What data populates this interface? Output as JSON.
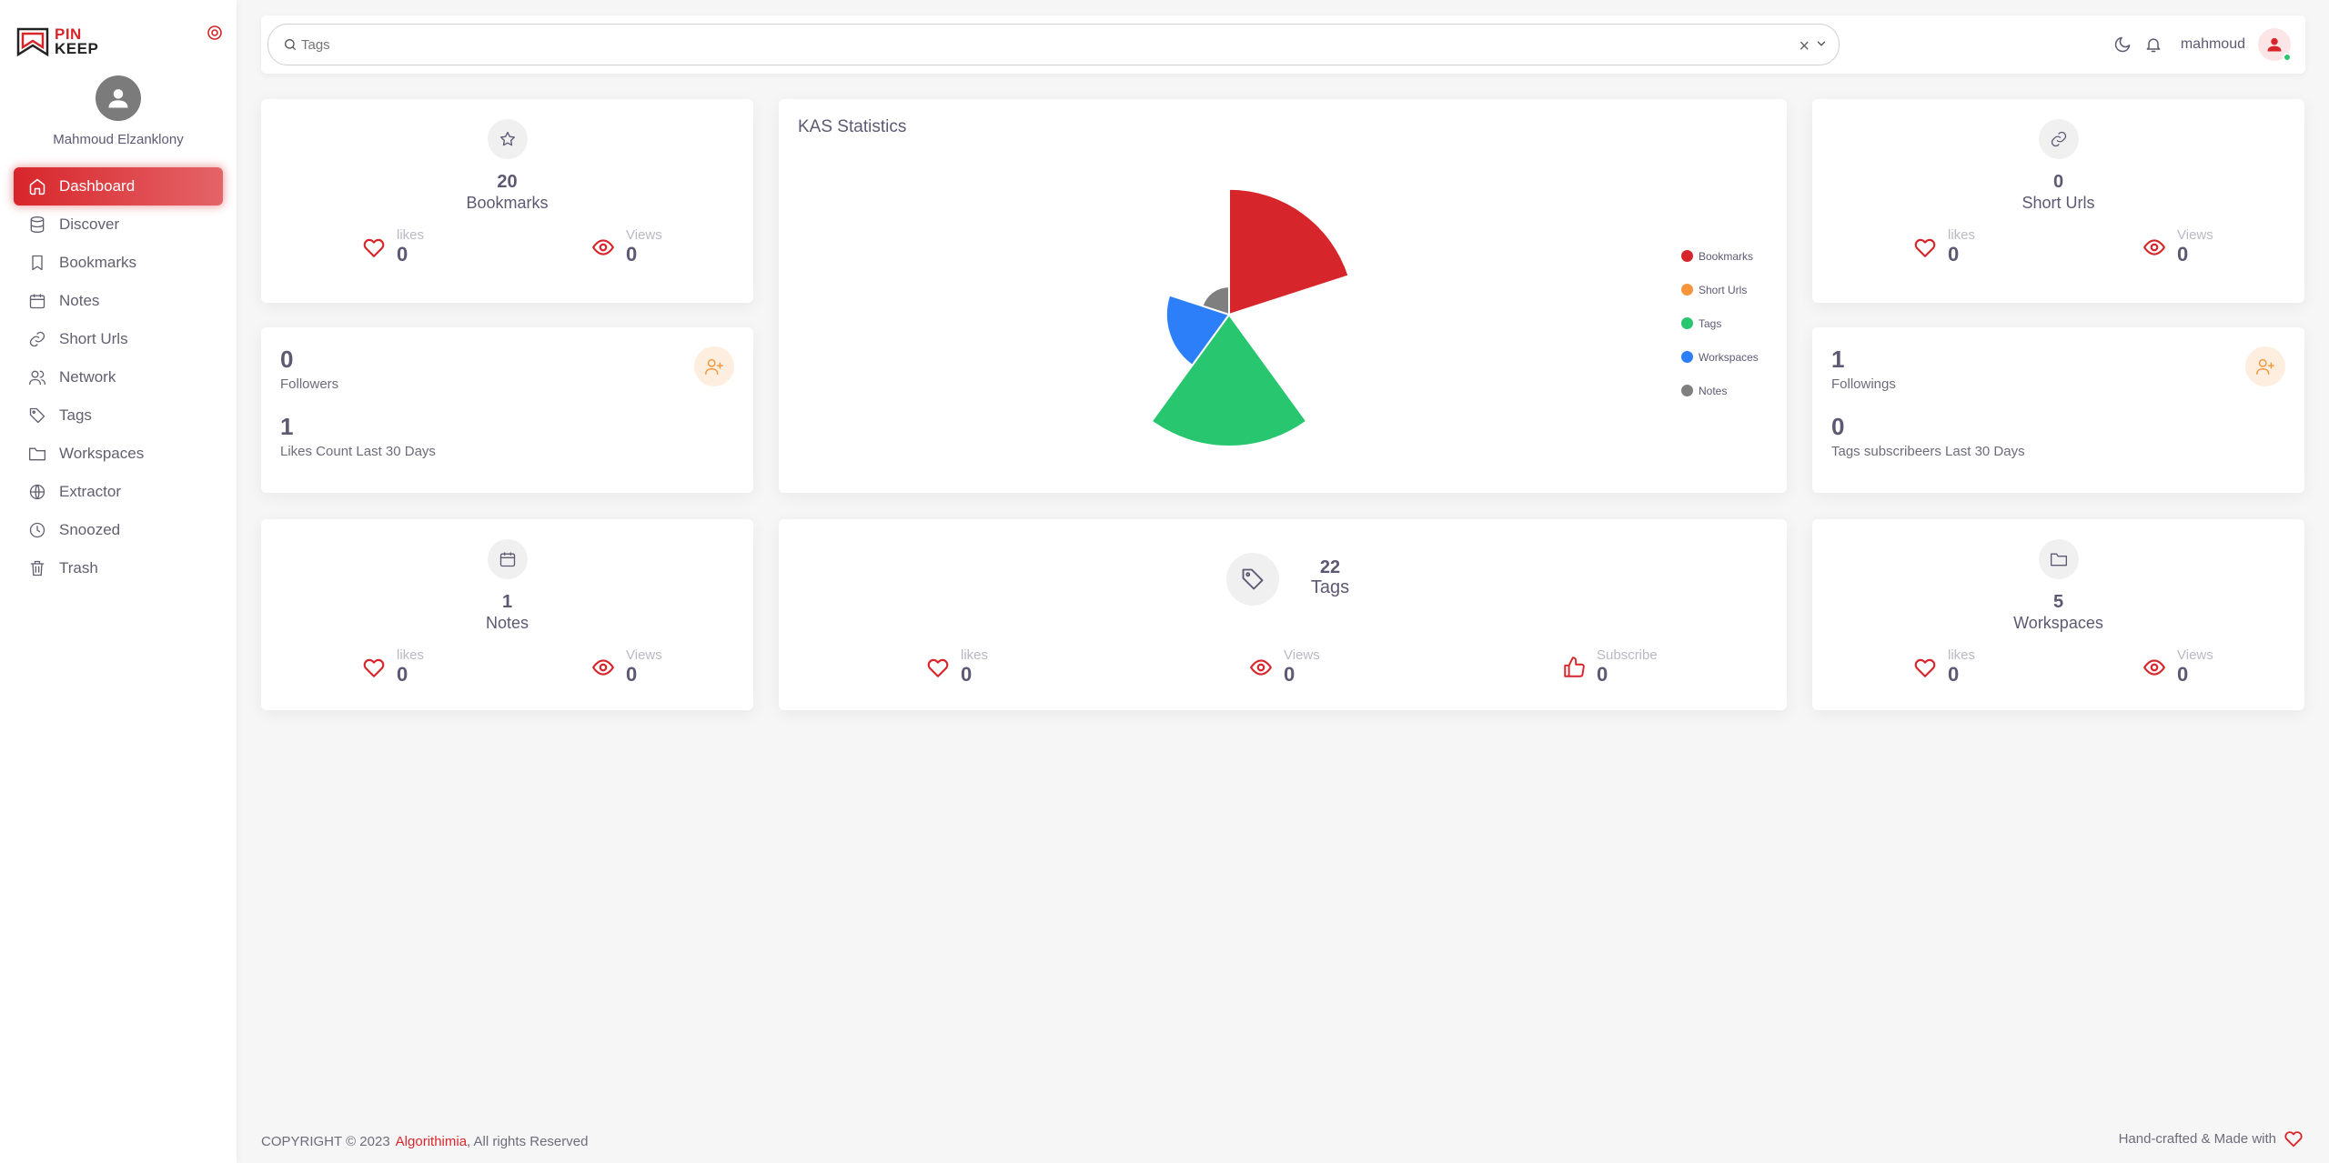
{
  "sidebar": {
    "logo": {
      "line1": "PIN",
      "line2": "KEEP"
    },
    "user_name": "Mahmoud Elzanklony",
    "items": [
      {
        "label": "Dashboard",
        "icon": "home-icon",
        "active": true
      },
      {
        "label": "Discover",
        "icon": "database-icon"
      },
      {
        "label": "Bookmarks",
        "icon": "bookmark-icon"
      },
      {
        "label": "Notes",
        "icon": "calendar-icon"
      },
      {
        "label": "Short Urls",
        "icon": "link-icon"
      },
      {
        "label": "Network",
        "icon": "users-icon"
      },
      {
        "label": "Tags",
        "icon": "tag-icon"
      },
      {
        "label": "Workspaces",
        "icon": "folder-icon"
      },
      {
        "label": "Extractor",
        "icon": "globe-icon"
      },
      {
        "label": "Snoozed",
        "icon": "clock-icon"
      },
      {
        "label": "Trash",
        "icon": "trash-icon"
      }
    ]
  },
  "header": {
    "search_placeholder": "Tags",
    "username": "mahmoud"
  },
  "cards": {
    "bookmarks": {
      "count": "20",
      "label": "Bookmarks",
      "likes_label": "likes",
      "likes": "0",
      "views_label": "Views",
      "views": "0"
    },
    "short_urls": {
      "count": "0",
      "label": "Short Urls",
      "likes_label": "likes",
      "likes": "0",
      "views_label": "Views",
      "views": "0"
    },
    "followers": {
      "count": "0",
      "label": "Followers",
      "sub_count": "1",
      "sub_label": "Likes Count Last 30 Days"
    },
    "followings": {
      "count": "1",
      "label": "Followings",
      "sub_count": "0",
      "sub_label": "Tags subscribeers Last 30 Days"
    },
    "notes": {
      "count": "1",
      "label": "Notes",
      "likes_label": "likes",
      "likes": "0",
      "views_label": "Views",
      "views": "0"
    },
    "tags": {
      "count": "22",
      "label": "Tags",
      "likes_label": "likes",
      "likes": "0",
      "views_label": "Views",
      "views": "0",
      "subscribe_label": "Subscribe",
      "subscribe": "0"
    },
    "workspaces": {
      "count": "5",
      "label": "Workspaces",
      "likes_label": "likes",
      "likes": "0",
      "views_label": "Views",
      "views": "0"
    }
  },
  "chart_data": {
    "type": "pie",
    "title": "KAS Statistics",
    "variant": "polar-area",
    "categories": [
      "Bookmarks",
      "Short Urls",
      "Tags",
      "Workspaces",
      "Notes"
    ],
    "values": [
      20,
      0,
      22,
      5,
      1
    ],
    "colors": [
      "#d7262b",
      "#f5963c",
      "#28c76f",
      "#2d7ff9",
      "#7f7f7f"
    ],
    "legend_position": "right"
  },
  "footer": {
    "copyright": "COPYRIGHT © 2023",
    "brand": "Algorithimia",
    "rights": ", All rights Reserved",
    "right_text": "Hand-crafted & Made with"
  },
  "colors": {
    "accent": "#d7262b",
    "success": "#28c76f",
    "warning": "#f5963c"
  }
}
